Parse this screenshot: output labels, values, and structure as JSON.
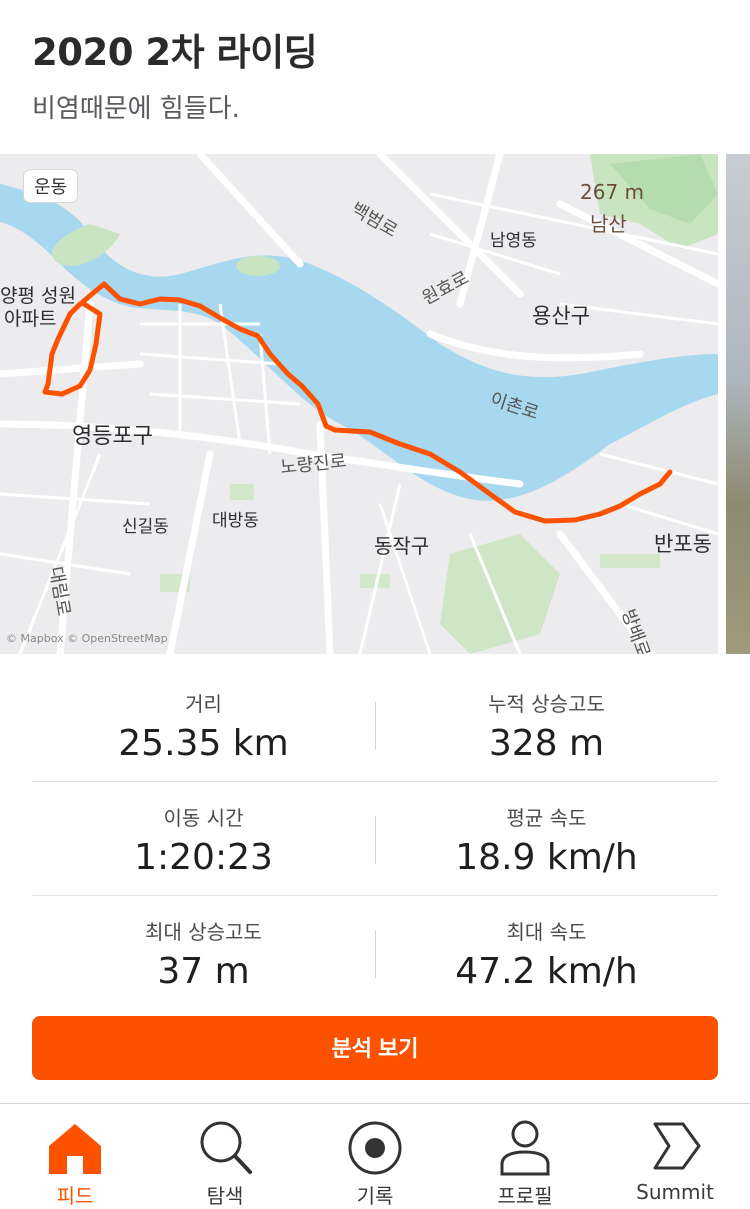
{
  "activity": {
    "title": "2020 2차 라이딩",
    "description": "비염때문에 힘들다."
  },
  "map": {
    "sport_tag": "운동",
    "attribution": "© Mapbox © OpenStreetMap",
    "labels": {
      "yeongdeungpo": "영등포구",
      "yongsan": "용산구",
      "dongjak": "동작구",
      "namyeong": "남영동",
      "singil": "신길동",
      "daebang": "대방동",
      "banpo": "반포동",
      "apt1": "양평 성원",
      "apt2": "아파트",
      "mountain_elev": "267 m",
      "mountain_name": "남산",
      "baekbeom": "백범로",
      "wonhyo": "원효로",
      "ichon": "이촌로",
      "noryangjin": "노량진로",
      "daerim": "대림로",
      "banpo_st": "방배로"
    },
    "route_color": "#fc5200"
  },
  "stats": [
    {
      "label": "거리",
      "value": "25.35 km"
    },
    {
      "label": "누적 상승고도",
      "value": "328 m"
    },
    {
      "label": "이동 시간",
      "value": "1:20:23"
    },
    {
      "label": "평균 속도",
      "value": "18.9 km/h"
    },
    {
      "label": "최대 상승고도",
      "value": "37 m"
    },
    {
      "label": "최대 속도",
      "value": "47.2 km/h"
    }
  ],
  "analyze_button": "분석 보기",
  "tabs": [
    {
      "label": "피드",
      "icon": "home-icon",
      "active": true
    },
    {
      "label": "탐색",
      "icon": "search-icon",
      "active": false
    },
    {
      "label": "기록",
      "icon": "record-icon",
      "active": false
    },
    {
      "label": "프로필",
      "icon": "profile-icon",
      "active": false
    },
    {
      "label": "Summit",
      "icon": "summit-icon",
      "active": false
    }
  ],
  "colors": {
    "accent": "#fc5200",
    "river": "#a8d8ef",
    "park": "#c8e6c0"
  }
}
